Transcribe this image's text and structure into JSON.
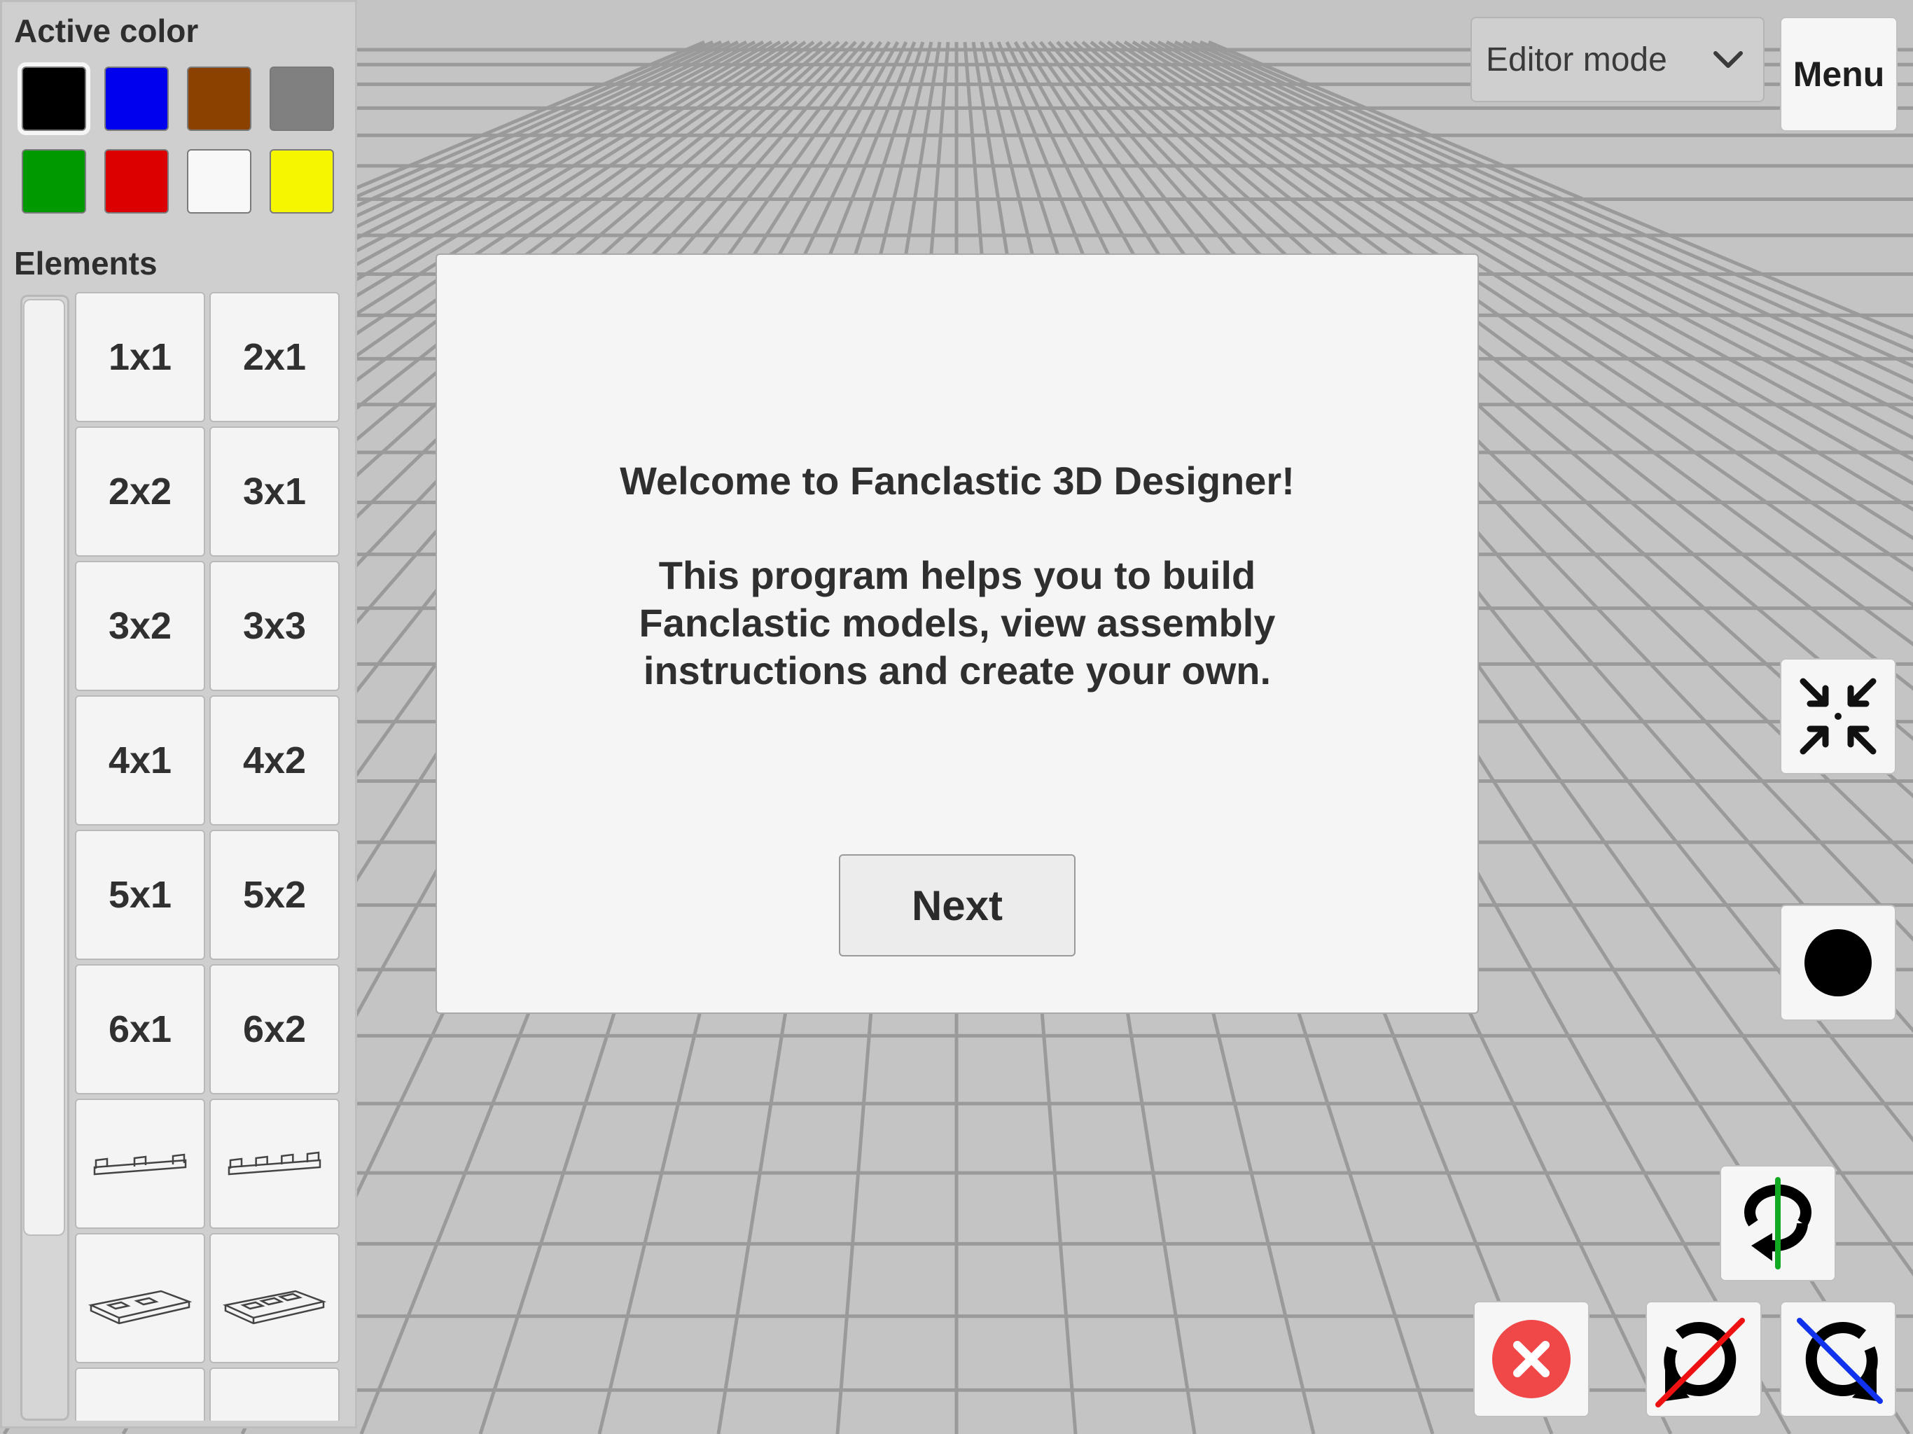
{
  "palette": {
    "title": "Active color",
    "selected_index": 0,
    "colors": [
      "#000000",
      "#0000ee",
      "#8b4200",
      "#808080",
      "#009900",
      "#dd0000",
      "#f8f8f8",
      "#f6f600"
    ]
  },
  "elements": {
    "title": "Elements",
    "items": [
      {
        "label": "1x1"
      },
      {
        "label": "2x1"
      },
      {
        "label": "2x2"
      },
      {
        "label": "3x1"
      },
      {
        "label": "3x2"
      },
      {
        "label": "3x3"
      },
      {
        "label": "4x1"
      },
      {
        "label": "4x2"
      },
      {
        "label": "5x1"
      },
      {
        "label": "5x2"
      },
      {
        "label": "6x1"
      },
      {
        "label": "6x2"
      },
      {
        "label": "",
        "icon": "connector-3-icon"
      },
      {
        "label": "",
        "icon": "connector-4-icon"
      },
      {
        "label": "",
        "icon": "plate-2-icon"
      },
      {
        "label": "",
        "icon": "plate-3-icon"
      },
      {
        "label": "",
        "icon": "brick-2-icon"
      },
      {
        "label": "",
        "icon": "brick-3-icon"
      }
    ]
  },
  "toolbar": {
    "mode_value": "Editor mode",
    "menu_label": "Menu"
  },
  "dialog": {
    "title": "Welcome to Fanclastic 3D Designer!",
    "body_lines": [
      "This program helps you to build",
      "Fanclastic models, view assembly",
      "instructions and create your own."
    ],
    "next_label": "Next"
  },
  "tools": {
    "icons": [
      "collapse-icon",
      "record-dot-icon",
      "rotate-y-icon",
      "delete-icon",
      "rotate-x-icon",
      "rotate-z-icon"
    ]
  }
}
